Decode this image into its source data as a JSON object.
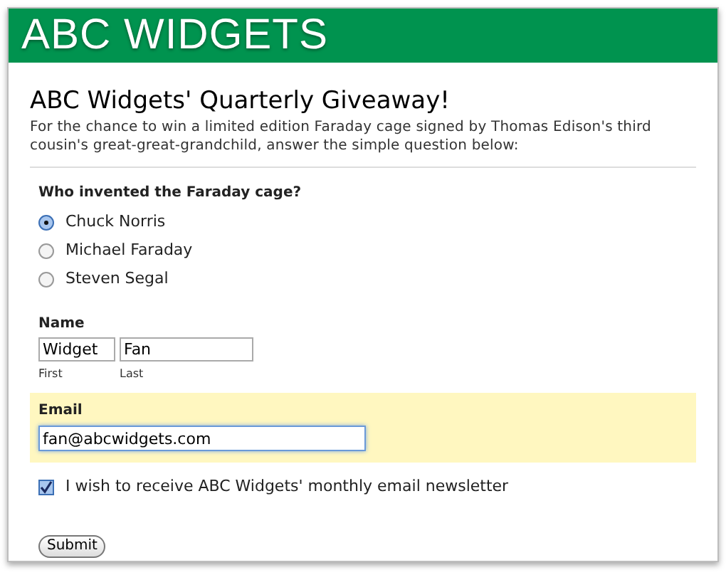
{
  "header": {
    "brand": "ABC WIDGETS"
  },
  "title": "ABC Widgets' Quarterly Giveaway!",
  "intro": "For the chance to win a limited edition Faraday cage signed by Thomas Edison's third cousin's great-great-grandchild, answer the simple question below:",
  "question": {
    "label": "Who invented the Faraday cage?",
    "options": [
      {
        "label": "Chuck Norris",
        "selected": true
      },
      {
        "label": "Michael Faraday",
        "selected": false
      },
      {
        "label": "Steven Segal",
        "selected": false
      }
    ]
  },
  "name": {
    "label": "Name",
    "first": {
      "value": "Widget",
      "caption": "First"
    },
    "last": {
      "value": "Fan",
      "caption": "Last"
    }
  },
  "email": {
    "label": "Email",
    "value": "fan@abcwidgets.com",
    "focused": true,
    "highlighted": true
  },
  "newsletter": {
    "label": "I wish to receive ABC Widgets' monthly email newsletter",
    "checked": true
  },
  "submit": "Submit"
}
